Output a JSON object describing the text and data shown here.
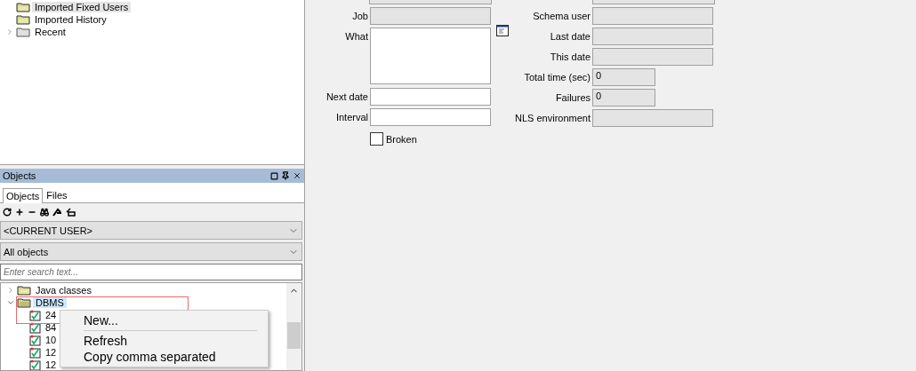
{
  "browser_tree": {
    "items": [
      {
        "label": "Imported Fixed Users",
        "selected": true
      },
      {
        "label": "Imported History",
        "selected": false
      },
      {
        "label": "Recent",
        "selected": false,
        "expanded": false
      }
    ]
  },
  "objects_panel": {
    "title": "Objects",
    "tabs": [
      {
        "label": "Objects",
        "selected": true
      },
      {
        "label": "Files",
        "selected": false
      }
    ],
    "owner_select": {
      "value": "<CURRENT USER>"
    },
    "filter_select": {
      "value": "All objects"
    },
    "search": {
      "placeholder": "Enter search text..."
    },
    "tree": [
      {
        "label": "Java classes",
        "selected": false,
        "expanded": false
      },
      {
        "label": "DBMS",
        "selected": true,
        "expanded": true,
        "children": [
          {
            "label": "24",
            "selected": false
          },
          {
            "label": "84",
            "selected": false
          },
          {
            "label": "10",
            "selected": false
          },
          {
            "label": "12",
            "selected": false
          },
          {
            "label": "12",
            "selected": false
          }
        ]
      }
    ]
  },
  "context_menu": {
    "items": [
      {
        "kind": "item",
        "label": "New..."
      },
      {
        "kind": "separator"
      },
      {
        "kind": "item",
        "label": "Refresh"
      },
      {
        "kind": "item",
        "label": "Copy comma separated"
      }
    ]
  },
  "job_form": {
    "left_fields": [
      {
        "label": "Job",
        "kind": "readonly"
      },
      {
        "label": "What",
        "kind": "textarea"
      },
      {
        "label": "Next date",
        "kind": "input"
      },
      {
        "label": "Interval",
        "kind": "input"
      }
    ],
    "broken": {
      "label": "Broken",
      "checked": false
    },
    "right_fields": [
      {
        "label": "Schema user",
        "kind": "readonly"
      },
      {
        "label": "Last date",
        "kind": "readonly"
      },
      {
        "label": "This date",
        "kind": "readonly"
      },
      {
        "label": "Total time (sec)",
        "kind": "short",
        "value": "0"
      },
      {
        "label": "Failures",
        "kind": "short",
        "value": "0"
      },
      {
        "label": "NLS environment",
        "kind": "readonly"
      }
    ]
  }
}
